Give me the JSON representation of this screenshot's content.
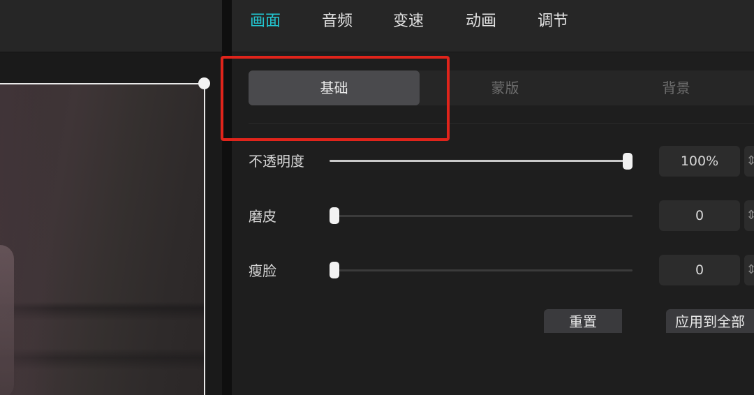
{
  "tabs": [
    "画面",
    "音频",
    "变速",
    "动画",
    "调节"
  ],
  "active_tab": "画面",
  "subtabs": [
    "基础",
    "蒙版",
    "背景"
  ],
  "active_subtab": "基础",
  "adjustments": [
    {
      "label": "不透明度",
      "value": "100%",
      "level": 1.0
    },
    {
      "label": "磨皮",
      "value": "0",
      "level": 0.0
    },
    {
      "label": "瘦脸",
      "value": "0",
      "level": 0.0
    }
  ],
  "buttons": {
    "reset": "重置",
    "apply_all": "应用到全部"
  },
  "colors": {
    "active_tab": "#22c6d1",
    "highlight_box": "#e0241b"
  }
}
